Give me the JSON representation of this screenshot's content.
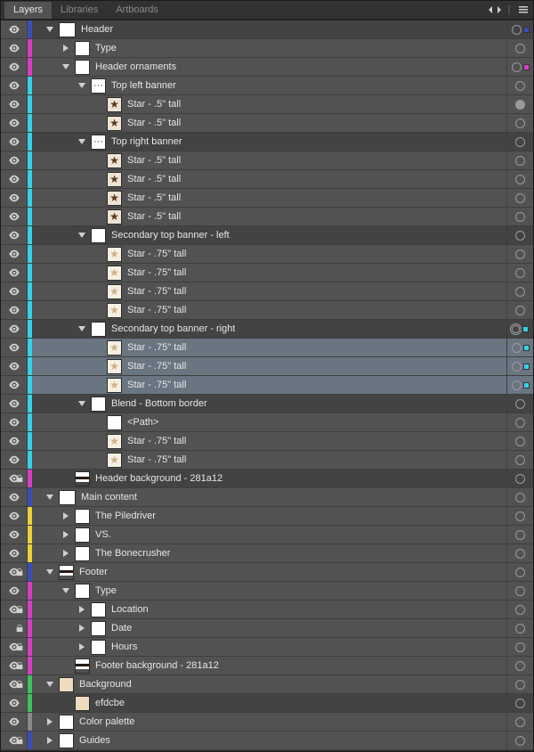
{
  "tabs": {
    "layers": "Layers",
    "libraries": "Libraries",
    "artboards": "Artboards"
  },
  "colors": {
    "blue_indigo": "#3d4db8",
    "magenta": "#d63fc4",
    "cyan": "#36d0e8",
    "yellow": "#e8d23a",
    "green": "#3fc25e",
    "gray": "#8a8a8a",
    "sel_blue": "#1f8fff",
    "sel_cyan": "#36d0e8"
  },
  "rows": [
    {
      "id": "header",
      "label": "Header",
      "depth": 0,
      "arrow": "down",
      "color": "blue_indigo",
      "thumb": "th-wide",
      "vis": true,
      "lock": false,
      "dark": true,
      "target": "ring",
      "sel": "blue_indigo"
    },
    {
      "id": "type",
      "label": "Type",
      "depth": 1,
      "arrow": "right",
      "color": "magenta",
      "thumb": "th-white",
      "vis": true,
      "lock": false,
      "dark": false,
      "target": "ring"
    },
    {
      "id": "ornaments",
      "label": "Header ornaments",
      "depth": 1,
      "arrow": "down",
      "color": "magenta",
      "thumb": "th-white",
      "vis": true,
      "lock": false,
      "dark": false,
      "target": "ring",
      "sel": "magenta"
    },
    {
      "id": "tlb",
      "label": "Top left banner",
      "depth": 2,
      "arrow": "down",
      "color": "cyan",
      "thumb": "th-dots",
      "vis": true,
      "lock": false,
      "dark": false,
      "target": "ring"
    },
    {
      "id": "tlb-s1",
      "label": "Star - .5\" tall",
      "depth": 3,
      "arrow": "none",
      "color": "cyan",
      "thumb": "th-star5",
      "vis": true,
      "lock": false,
      "dark": false,
      "target": "filled"
    },
    {
      "id": "tlb-s2",
      "label": "Star - .5\" tall",
      "depth": 3,
      "arrow": "none",
      "color": "cyan",
      "thumb": "th-star5",
      "vis": true,
      "lock": false,
      "dark": false,
      "target": "ring"
    },
    {
      "id": "trb",
      "label": "Top right banner",
      "depth": 2,
      "arrow": "down",
      "color": "cyan",
      "thumb": "th-dots",
      "vis": true,
      "lock": false,
      "dark": true,
      "target": "ring"
    },
    {
      "id": "trb-s1",
      "label": "Star - .5\" tall",
      "depth": 3,
      "arrow": "none",
      "color": "cyan",
      "thumb": "th-star5",
      "vis": true,
      "lock": false,
      "dark": false,
      "target": "ring"
    },
    {
      "id": "trb-s2",
      "label": "Star - .5\" tall",
      "depth": 3,
      "arrow": "none",
      "color": "cyan",
      "thumb": "th-star5",
      "vis": true,
      "lock": false,
      "dark": false,
      "target": "ring"
    },
    {
      "id": "trb-s3",
      "label": "Star - .5\" tall",
      "depth": 3,
      "arrow": "none",
      "color": "cyan",
      "thumb": "th-star5",
      "vis": true,
      "lock": false,
      "dark": false,
      "target": "ring"
    },
    {
      "id": "trb-s4",
      "label": "Star - .5\" tall",
      "depth": 3,
      "arrow": "none",
      "color": "cyan",
      "thumb": "th-star5",
      "vis": true,
      "lock": false,
      "dark": false,
      "target": "ring"
    },
    {
      "id": "stl",
      "label": "Secondary top banner - left",
      "depth": 2,
      "arrow": "down",
      "color": "cyan",
      "thumb": "th-white",
      "vis": true,
      "lock": false,
      "dark": true,
      "target": "ring"
    },
    {
      "id": "stl-s1",
      "label": "Star - .75\" tall",
      "depth": 3,
      "arrow": "none",
      "color": "cyan",
      "thumb": "th-star75",
      "vis": true,
      "lock": false,
      "dark": false,
      "target": "ring"
    },
    {
      "id": "stl-s2",
      "label": "Star - .75\" tall",
      "depth": 3,
      "arrow": "none",
      "color": "cyan",
      "thumb": "th-star75",
      "vis": true,
      "lock": false,
      "dark": false,
      "target": "ring"
    },
    {
      "id": "stl-s3",
      "label": "Star - .75\" tall",
      "depth": 3,
      "arrow": "none",
      "color": "cyan",
      "thumb": "th-star75",
      "vis": true,
      "lock": false,
      "dark": false,
      "target": "ring"
    },
    {
      "id": "stl-s4",
      "label": "Star - .75\" tall",
      "depth": 3,
      "arrow": "none",
      "color": "cyan",
      "thumb": "th-star75",
      "vis": true,
      "lock": false,
      "dark": false,
      "target": "ring"
    },
    {
      "id": "str",
      "label": "Secondary top banner - right",
      "depth": 2,
      "arrow": "down",
      "color": "cyan",
      "thumb": "th-white",
      "vis": true,
      "lock": false,
      "dark": true,
      "target": "dbl",
      "sel": "sel_cyan"
    },
    {
      "id": "str-s1",
      "label": "Star - .75\" tall",
      "depth": 3,
      "arrow": "none",
      "color": "cyan",
      "thumb": "th-star75",
      "vis": true,
      "lock": false,
      "dark": false,
      "target": "ring",
      "sel": "sel_cyan",
      "selected": true
    },
    {
      "id": "str-s2",
      "label": "Star - .75\" tall",
      "depth": 3,
      "arrow": "none",
      "color": "cyan",
      "thumb": "th-star75",
      "vis": true,
      "lock": false,
      "dark": false,
      "target": "ring",
      "sel": "sel_cyan",
      "selected": true
    },
    {
      "id": "str-s3",
      "label": "Star - .75\" tall",
      "depth": 3,
      "arrow": "none",
      "color": "cyan",
      "thumb": "th-star75",
      "vis": true,
      "lock": false,
      "dark": false,
      "target": "ring",
      "sel": "sel_cyan",
      "selected": true
    },
    {
      "id": "blend",
      "label": "Blend - Bottom border",
      "depth": 2,
      "arrow": "down",
      "color": "cyan",
      "thumb": "th-white",
      "vis": true,
      "lock": false,
      "dark": true,
      "target": "ring"
    },
    {
      "id": "blend-path",
      "label": "<Path>",
      "depth": 3,
      "arrow": "none",
      "color": "cyan",
      "thumb": "th-white",
      "vis": true,
      "lock": false,
      "dark": false,
      "target": "ring"
    },
    {
      "id": "blend-s1",
      "label": "Star - .75\" tall",
      "depth": 3,
      "arrow": "none",
      "color": "cyan",
      "thumb": "th-star75",
      "vis": true,
      "lock": false,
      "dark": false,
      "target": "ring"
    },
    {
      "id": "blend-s2",
      "label": "Star - .75\" tall",
      "depth": 3,
      "arrow": "none",
      "color": "cyan",
      "thumb": "th-star75",
      "vis": true,
      "lock": false,
      "dark": false,
      "target": "ring"
    },
    {
      "id": "hdr-bg",
      "label": "Header background - 281a12",
      "depth": 1,
      "arrow": "none",
      "color": "magenta",
      "thumb": "th-hstripe",
      "vis": true,
      "lock": true,
      "dark": true,
      "target": "ring"
    },
    {
      "id": "main",
      "label": "Main content",
      "depth": 0,
      "arrow": "down",
      "color": "blue_indigo",
      "thumb": "th-wide",
      "vis": true,
      "lock": false,
      "dark": false,
      "target": "ring"
    },
    {
      "id": "piledriver",
      "label": "The Piledriver",
      "depth": 1,
      "arrow": "right",
      "color": "yellow",
      "thumb": "th-white",
      "vis": true,
      "lock": false,
      "dark": false,
      "target": "ring"
    },
    {
      "id": "vs",
      "label": "VS.",
      "depth": 1,
      "arrow": "right",
      "color": "yellow",
      "thumb": "th-white",
      "vis": true,
      "lock": false,
      "dark": false,
      "target": "ring"
    },
    {
      "id": "bonecrusher",
      "label": "The Bonecrusher",
      "depth": 1,
      "arrow": "right",
      "color": "yellow",
      "thumb": "th-white",
      "vis": true,
      "lock": false,
      "dark": false,
      "target": "ring"
    },
    {
      "id": "footer",
      "label": "Footer",
      "depth": 0,
      "arrow": "down",
      "color": "blue_indigo",
      "thumb": "th-hstripe",
      "vis": true,
      "lock": true,
      "dark": false,
      "target": "ring"
    },
    {
      "id": "ftype",
      "label": "Type",
      "depth": 1,
      "arrow": "down",
      "color": "magenta",
      "thumb": "th-white",
      "vis": true,
      "lock": false,
      "dark": false,
      "target": "ring"
    },
    {
      "id": "loc",
      "label": "Location",
      "depth": 2,
      "arrow": "right",
      "color": "magenta",
      "thumb": "th-white",
      "vis": true,
      "lock": true,
      "dark": false,
      "target": "ring"
    },
    {
      "id": "date",
      "label": "Date",
      "depth": 2,
      "arrow": "right",
      "color": "magenta",
      "thumb": "th-white",
      "vis": false,
      "lock": true,
      "dark": false,
      "target": "ring"
    },
    {
      "id": "hours",
      "label": "Hours",
      "depth": 2,
      "arrow": "right",
      "color": "magenta",
      "thumb": "th-white",
      "vis": true,
      "lock": true,
      "dark": false,
      "target": "ring"
    },
    {
      "id": "ftr-bg",
      "label": "Footer background - 281a12",
      "depth": 1,
      "arrow": "none",
      "color": "magenta",
      "thumb": "th-hstripe",
      "vis": true,
      "lock": true,
      "dark": false,
      "target": "ring"
    },
    {
      "id": "bg",
      "label": "Background",
      "depth": 0,
      "arrow": "down",
      "color": "green",
      "thumb": "th-cream",
      "vis": true,
      "lock": true,
      "dark": false,
      "target": "ring"
    },
    {
      "id": "bg-c",
      "label": "efdcbe",
      "depth": 1,
      "arrow": "none",
      "color": "green",
      "thumb": "th-cream",
      "vis": true,
      "lock": false,
      "dark": true,
      "target": "ring"
    },
    {
      "id": "cpal",
      "label": "Color palette",
      "depth": 0,
      "arrow": "right",
      "color": "gray",
      "thumb": "th-white",
      "vis": true,
      "lock": false,
      "dark": false,
      "target": "ring"
    },
    {
      "id": "guides",
      "label": "Guides",
      "depth": 0,
      "arrow": "right",
      "color": "blue_indigo",
      "thumb": "th-white",
      "vis": true,
      "lock": true,
      "dark": false,
      "target": "ring"
    }
  ]
}
